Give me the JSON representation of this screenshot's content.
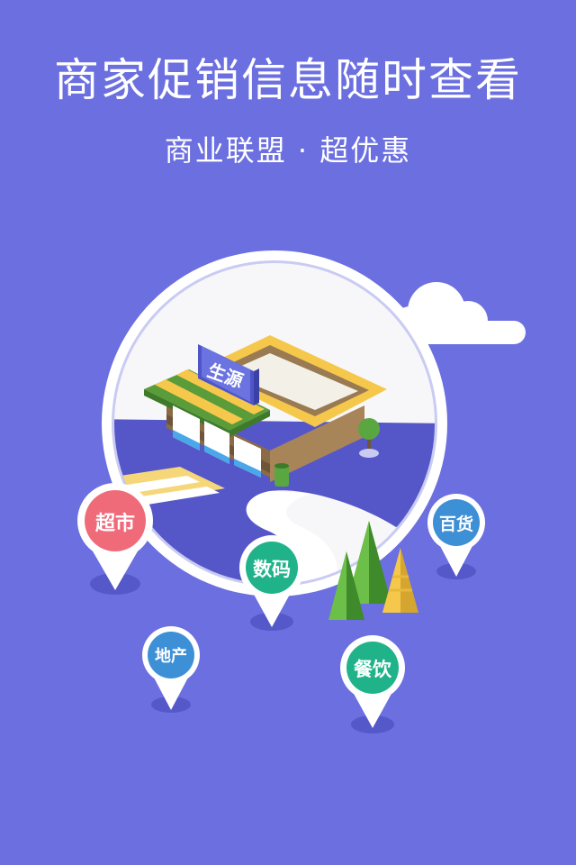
{
  "hero": {
    "headline": "商家促销信息随时查看",
    "subline": "商业联盟 · 超优惠"
  },
  "store": {
    "sign": "生源"
  },
  "pins": [
    {
      "id": "supermarket",
      "label": "超市",
      "color": "#f06b7a"
    },
    {
      "id": "digital",
      "label": "数码",
      "color": "#20b38a"
    },
    {
      "id": "department",
      "label": "百货",
      "color": "#3d8fd6"
    },
    {
      "id": "realestate",
      "label": "地产",
      "color": "#3d8fd6"
    },
    {
      "id": "dining",
      "label": "餐饮",
      "color": "#20b38a"
    }
  ],
  "colors": {
    "background": "#6b6fe0",
    "circle_border": "#ffffff",
    "road": "#4e4fc9"
  }
}
